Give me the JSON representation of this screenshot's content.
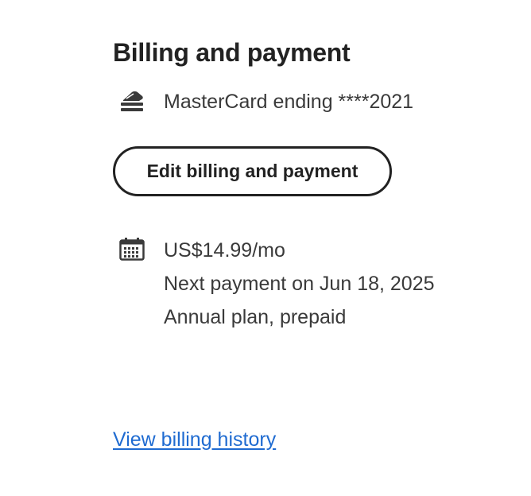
{
  "billing": {
    "title": "Billing and payment",
    "card_icon": "credit-card-icon",
    "card_text": "MasterCard ending ****2021",
    "edit_button_label": "Edit billing and payment",
    "plan_icon": "calendar-icon",
    "plan_price": "US$14.99/mo",
    "next_payment": "Next payment on Jun 18, 2025",
    "plan_type": "Annual plan, prepaid",
    "history_link_label": "View billing history"
  },
  "colors": {
    "text": "#2c2c2c",
    "title": "#222222",
    "link": "#1f6bd1",
    "button_border": "#222222",
    "icon": "#3a3a3a"
  }
}
